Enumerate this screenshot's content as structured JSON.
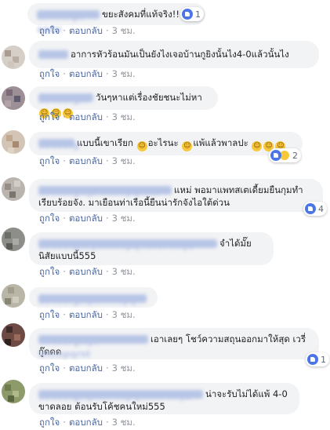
{
  "comments": [
    {
      "name": "abcdefgh aaan",
      "text": "ขยะสังคมที่แท้จริง!!",
      "reaction_count": "1",
      "time": "3 ชม."
    },
    {
      "name": "",
      "text": "อาการหัวร้อนมันเป็นยังไงเจอบ้านกูยิงนั้นไง4-0แล้วนั้นไง",
      "reaction_count": "",
      "time": "3 ชม."
    },
    {
      "name": "abcdefghi",
      "text": "วันๆหาแต่เรื่องชัยชนะไม่หา",
      "reaction_count": "",
      "time": "3 ชม."
    },
    {
      "name": "abcdefg",
      "text_a": "แบบนี้เขาเรียก",
      "text_b": "อะไรนะ",
      "text_c": "แพ้แล้วพาลปะ",
      "reaction_count": "2",
      "time": "3 ชม."
    },
    {
      "name": "abcdefghijk lmnopqrstu",
      "text": "แหม่ พอมาแพทสเตเดี้ยมยืนกุมทำเรียบร้อยจัง. มาเยือนท่าเรือนี้ยืนน่ารักจังไอใต้ด่วน",
      "reaction_count": "4",
      "time": "3 ชม."
    },
    {
      "name": "abcdefghi jklmnopq rstuvwxyz",
      "text": "จำได้มั๊ยนิสัยแบบนี้555",
      "reaction_count": "",
      "time": "3 ชม."
    },
    {
      "name": "abcdefghijklmnopq",
      "text": "",
      "reaction_count": "",
      "time": "3 ชม."
    },
    {
      "name": "abcdefghijk lmnopqrst",
      "text": "เอาเลยๆ โชว์ความสถุนออกมาให้สุด เวรี่กู๊ดดด",
      "reaction_count": "1",
      "time": "3 ชม."
    },
    {
      "name": "abcdefghijklm nopqrstuvwxyz",
      "text": "น่าจะรับไม่ได้แพ้ 4-0 ขาดลอย ต้อนรับโค้ชคนใหม่555",
      "reaction_count": "",
      "time": "3 ชม."
    }
  ],
  "actions": {
    "like": "ถูกใจ",
    "reply": "ตอบกลับ",
    "sep": "·"
  },
  "colors": {
    "link": "#4b67a1",
    "bubble": "#f2f3f5",
    "like_blue": "#4a76e8"
  }
}
